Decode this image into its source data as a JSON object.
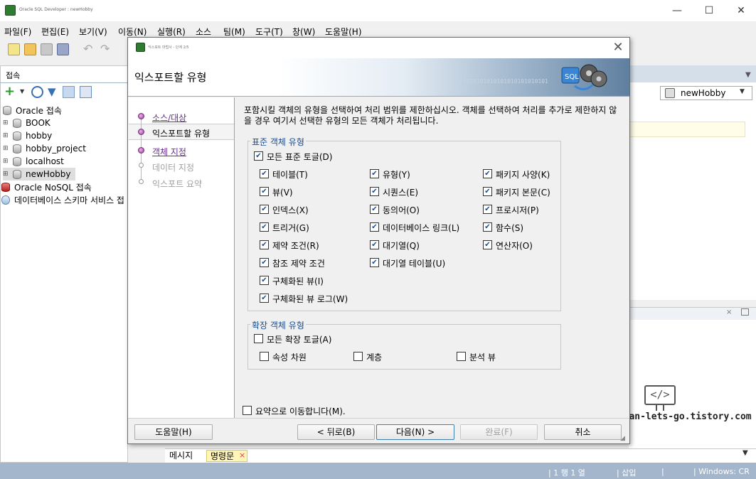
{
  "window": {
    "title": "Oracle SQL Developer : newHobby",
    "controls": [
      "—",
      "☐",
      "✕"
    ]
  },
  "menu": [
    "파일(F)",
    "편집(E)",
    "보기(V)",
    "이동(N)",
    "실행(R)",
    "소스",
    "팀(M)",
    "도구(T)",
    "창(W)",
    "도움말(H)"
  ],
  "left_panel": {
    "tab": "접속",
    "tree": [
      {
        "label": "Oracle 접속",
        "expander": ""
      },
      {
        "label": "BOOK",
        "expander": "⊞"
      },
      {
        "label": "hobby",
        "expander": "⊞"
      },
      {
        "label": "hobby_project",
        "expander": "⊞"
      },
      {
        "label": "localhost",
        "expander": "⊞"
      },
      {
        "label": "newHobby",
        "expander": "⊞"
      },
      {
        "label": "Oracle NoSQL 접속",
        "expander": ""
      },
      {
        "label": "데이터베이스 스키마 서비스 접",
        "expander": ""
      }
    ]
  },
  "right_panel": {
    "connection": "newHobby"
  },
  "bottom": {
    "tabs": [
      "메시지",
      "명령문"
    ],
    "close": "×"
  },
  "status": {
    "position": "| 1 행 1 열",
    "mode": "| 삽입",
    "sep": "|",
    "encoding": "| Windows: CR"
  },
  "watermark": "http://sean-lets-go.tistory.com",
  "dialog": {
    "title": "익스포트 마법사 - 단계 2/5",
    "header": "익스포트할 유형",
    "binary": "0101010101010101010101010101",
    "close": "✕",
    "nav": [
      {
        "label": "소스/대상",
        "state": "done"
      },
      {
        "label": "익스포트할 유형",
        "state": "current"
      },
      {
        "label": "객체 지정",
        "state": "done"
      },
      {
        "label": "데이터 지정",
        "state": "pending"
      },
      {
        "label": "익스포트 요약",
        "state": "pending"
      }
    ],
    "description": "포함시킬 객체의 유형을 선택하여 처리 범위를 제한하십시오. 객체를 선택하여 처리를 추가로 제한하지 않을 경우 여기서 선택한 유형의 모든 객체가 처리됩니다.",
    "standard_group": {
      "title": "표준 객체 유형",
      "toggle_all": "모든 표준 토글(D)",
      "col1": [
        "테이블(T)",
        "뷰(V)",
        "인덱스(X)",
        "트리거(G)",
        "제약 조건(R)",
        "참조 제약 조건",
        "구체화된 뷰(I)",
        "구체화된 뷰 로그(W)"
      ],
      "col2": [
        "유형(Y)",
        "시퀀스(E)",
        "동의어(O)",
        "데이터베이스 링크(L)",
        "대기열(Q)",
        "대기열 테이블(U)"
      ],
      "col3": [
        "패키지 사양(K)",
        "패키지 본문(C)",
        "프로시저(P)",
        "함수(S)",
        "연산자(O)"
      ]
    },
    "extended_group": {
      "title": "확장 객체 유형",
      "toggle_all": "모든 확장 토글(A)",
      "items": [
        "속성 차원",
        "계층",
        "분석 뷰"
      ]
    },
    "go_to_summary": "요약으로 이동합니다(M).",
    "buttons": {
      "help": "도움말(H)",
      "back": "< 뒤로(B)",
      "next": "다음(N) >",
      "finish": "완료(F)",
      "cancel": "취소"
    }
  }
}
